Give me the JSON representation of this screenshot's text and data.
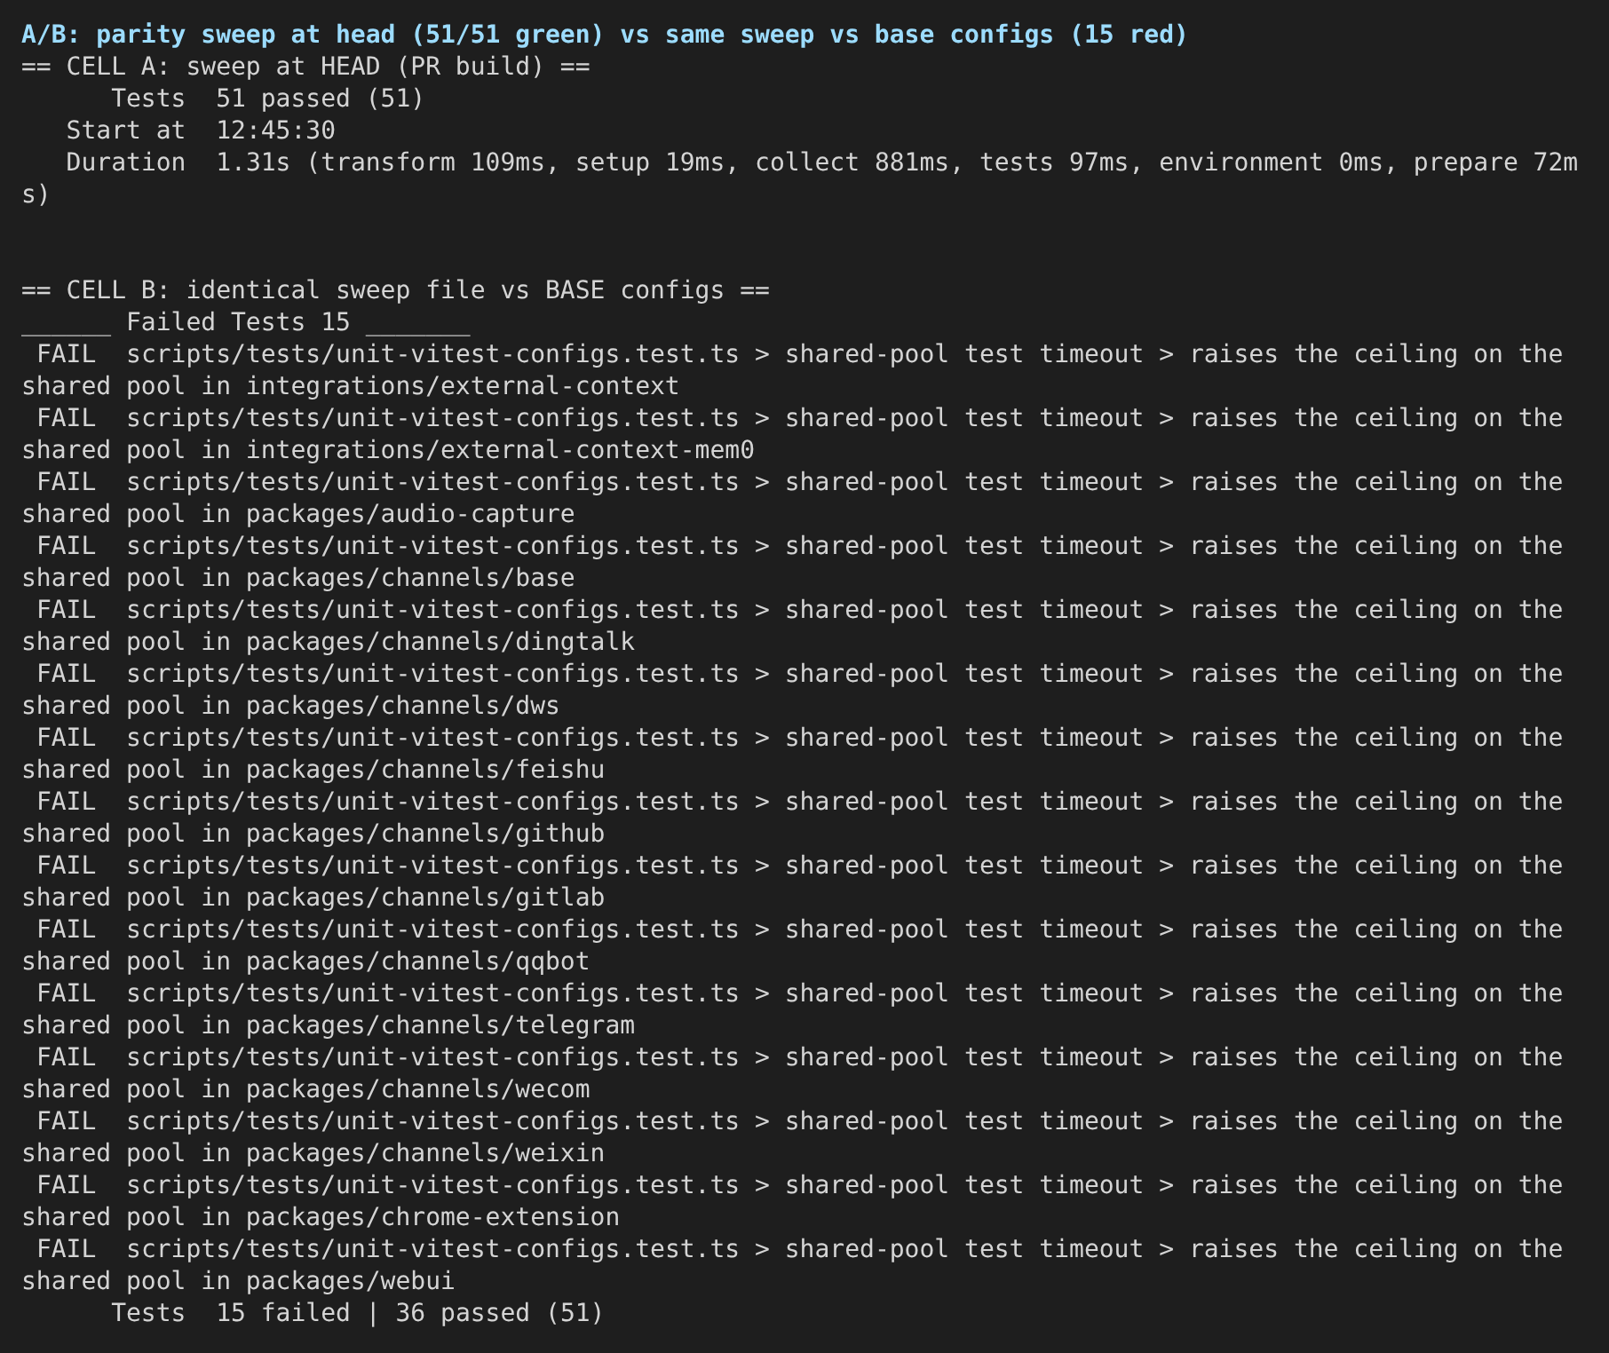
{
  "title": "A/B: parity sweep at head (51/51 green) vs same sweep vs base configs (15 red)",
  "cell_a": {
    "header": "== CELL A: sweep at HEAD (PR build) ==",
    "lines": [
      "      Tests  51 passed (51)",
      "   Start at  12:45:30",
      "   Duration  1.31s (transform 109ms, setup 19ms, collect 881ms, tests 97ms, environment 0ms, prepare 72ms)"
    ]
  },
  "cell_b": {
    "header": "== CELL B: identical sweep file vs BASE configs ==",
    "failed_header": "______ Failed Tests 15 _______",
    "failures": [
      " FAIL  scripts/tests/unit-vitest-configs.test.ts > shared-pool test timeout > raises the ceiling on the shared pool in integrations/external-context",
      " FAIL  scripts/tests/unit-vitest-configs.test.ts > shared-pool test timeout > raises the ceiling on the shared pool in integrations/external-context-mem0",
      " FAIL  scripts/tests/unit-vitest-configs.test.ts > shared-pool test timeout > raises the ceiling on the shared pool in packages/audio-capture",
      " FAIL  scripts/tests/unit-vitest-configs.test.ts > shared-pool test timeout > raises the ceiling on the shared pool in packages/channels/base",
      " FAIL  scripts/tests/unit-vitest-configs.test.ts > shared-pool test timeout > raises the ceiling on the shared pool in packages/channels/dingtalk",
      " FAIL  scripts/tests/unit-vitest-configs.test.ts > shared-pool test timeout > raises the ceiling on the shared pool in packages/channels/dws",
      " FAIL  scripts/tests/unit-vitest-configs.test.ts > shared-pool test timeout > raises the ceiling on the shared pool in packages/channels/feishu",
      " FAIL  scripts/tests/unit-vitest-configs.test.ts > shared-pool test timeout > raises the ceiling on the shared pool in packages/channels/github",
      " FAIL  scripts/tests/unit-vitest-configs.test.ts > shared-pool test timeout > raises the ceiling on the shared pool in packages/channels/gitlab",
      " FAIL  scripts/tests/unit-vitest-configs.test.ts > shared-pool test timeout > raises the ceiling on the shared pool in packages/channels/qqbot",
      " FAIL  scripts/tests/unit-vitest-configs.test.ts > shared-pool test timeout > raises the ceiling on the shared pool in packages/channels/telegram",
      " FAIL  scripts/tests/unit-vitest-configs.test.ts > shared-pool test timeout > raises the ceiling on the shared pool in packages/channels/wecom",
      " FAIL  scripts/tests/unit-vitest-configs.test.ts > shared-pool test timeout > raises the ceiling on the shared pool in packages/channels/weixin",
      " FAIL  scripts/tests/unit-vitest-configs.test.ts > shared-pool test timeout > raises the ceiling on the shared pool in packages/chrome-extension",
      " FAIL  scripts/tests/unit-vitest-configs.test.ts > shared-pool test timeout > raises the ceiling on the shared pool in packages/webui"
    ],
    "summary": "      Tests  15 failed | 36 passed (51)"
  }
}
